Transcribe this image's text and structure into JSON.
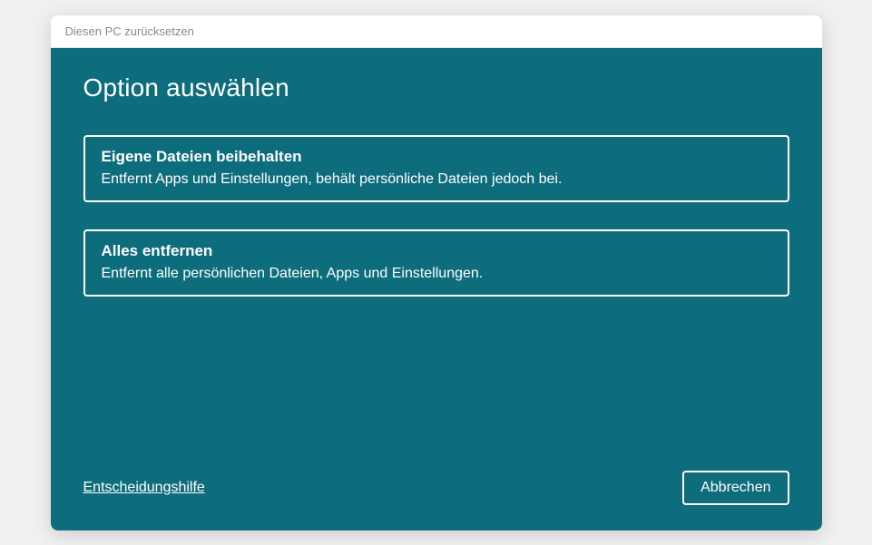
{
  "window": {
    "title": "Diesen PC zurücksetzen"
  },
  "page": {
    "heading": "Option auswählen"
  },
  "options": [
    {
      "title": "Eigene Dateien beibehalten",
      "description": "Entfernt Apps und Einstellungen, behält persönliche Dateien jedoch bei."
    },
    {
      "title": "Alles entfernen",
      "description": "Entfernt alle persönlichen Dateien, Apps und Einstellungen."
    }
  ],
  "footer": {
    "help_link": "Entscheidungshilfe",
    "cancel_label": "Abbrechen"
  }
}
